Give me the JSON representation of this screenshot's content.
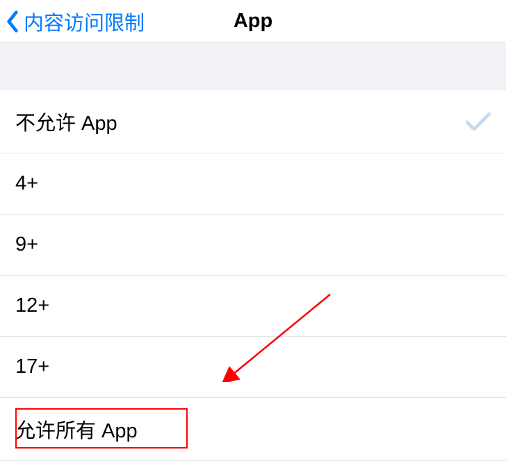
{
  "header": {
    "back_label": "内容访问限制",
    "title": "App"
  },
  "options": [
    {
      "label": "不允许 App",
      "selected": true
    },
    {
      "label": "4+",
      "selected": false
    },
    {
      "label": "9+",
      "selected": false
    },
    {
      "label": "12+",
      "selected": false
    },
    {
      "label": "17+",
      "selected": false
    },
    {
      "label": "允许所有 App",
      "selected": false
    }
  ]
}
